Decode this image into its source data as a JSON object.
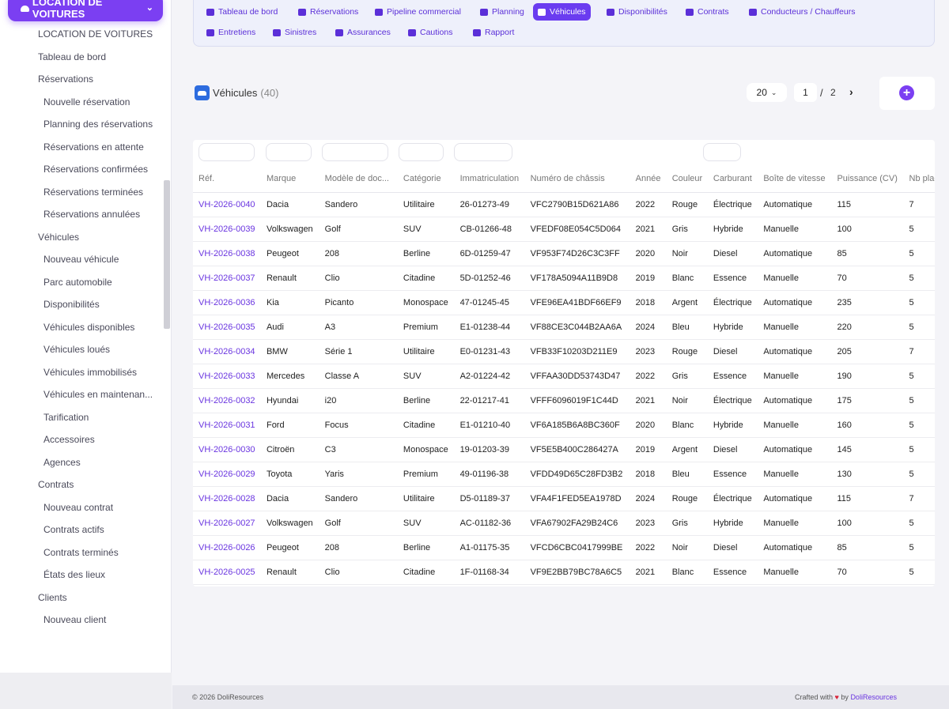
{
  "module": {
    "label": "LOCATION DE VOITURES"
  },
  "sidebar": {
    "items": [
      {
        "label": "LOCATION DE VOITURES",
        "level": 1
      },
      {
        "label": "Tableau de bord",
        "level": 1
      },
      {
        "label": "Réservations",
        "level": 1
      },
      {
        "label": "Nouvelle réservation",
        "level": 2
      },
      {
        "label": "Planning des réservations",
        "level": 2
      },
      {
        "label": "Réservations en attente",
        "level": 2
      },
      {
        "label": "Réservations confirmées",
        "level": 2
      },
      {
        "label": "Réservations terminées",
        "level": 2
      },
      {
        "label": "Réservations annulées",
        "level": 2
      },
      {
        "label": "Véhicules",
        "level": 1
      },
      {
        "label": "Nouveau véhicule",
        "level": 2
      },
      {
        "label": "Parc automobile",
        "level": 2
      },
      {
        "label": "Disponibilités",
        "level": 2
      },
      {
        "label": "Véhicules disponibles",
        "level": 2
      },
      {
        "label": "Véhicules loués",
        "level": 2
      },
      {
        "label": "Véhicules immobilisés",
        "level": 2
      },
      {
        "label": "Véhicules en maintenan...",
        "level": 2
      },
      {
        "label": "Tarification",
        "level": 2
      },
      {
        "label": "Accessoires",
        "level": 2
      },
      {
        "label": "Agences",
        "level": 2
      },
      {
        "label": "Contrats",
        "level": 1
      },
      {
        "label": "Nouveau contrat",
        "level": 2
      },
      {
        "label": "Contrats actifs",
        "level": 2
      },
      {
        "label": "Contrats terminés",
        "level": 2
      },
      {
        "label": "États des lieux",
        "level": 2
      },
      {
        "label": "Clients",
        "level": 1
      },
      {
        "label": "Nouveau client",
        "level": 2
      }
    ]
  },
  "tabs": [
    {
      "label": "Tableau de bord",
      "icon": "gauge-icon",
      "active": false
    },
    {
      "label": "Réservations",
      "icon": "calendar-check-icon",
      "active": false
    },
    {
      "label": "Pipeline commercial",
      "icon": "bars-icon",
      "active": false
    },
    {
      "label": "Planning",
      "icon": "calendar-icon",
      "active": false
    },
    {
      "label": "Véhicules",
      "icon": "car-icon",
      "active": true
    },
    {
      "label": "Disponibilités",
      "icon": "grid-icon",
      "active": false
    },
    {
      "label": "Contrats",
      "icon": "file-signature-icon",
      "active": false
    },
    {
      "label": "Conducteurs / Chauffeurs",
      "icon": "id-card-icon",
      "active": false
    },
    {
      "label": "Entretiens",
      "icon": "wrench-icon",
      "active": false
    },
    {
      "label": "Sinistres",
      "icon": "car-crash-icon",
      "active": false
    },
    {
      "label": "Assurances",
      "icon": "shield-icon",
      "active": false
    },
    {
      "label": "Cautions",
      "icon": "money-icon",
      "active": false
    },
    {
      "label": "Rapport",
      "icon": "chart-pie-icon",
      "active": false
    }
  ],
  "page": {
    "title": "Véhicules",
    "count": "(40)"
  },
  "pagination": {
    "per_page": "20",
    "current": "1",
    "separator": "/",
    "total": "2",
    "next": "›"
  },
  "add": {
    "label": "+"
  },
  "table": {
    "columns": [
      "Réf.",
      "Marque",
      "Modèle de doc...",
      "Catégorie",
      "Immatriculation",
      "Numéro de châssis",
      "Année",
      "Couleur",
      "Carburant",
      "Boîte de vitesse",
      "Puissance (CV)",
      "Nb places"
    ],
    "rows": [
      [
        "VH-2026-0040",
        "Dacia",
        "Sandero",
        "Utilitaire",
        "26-01273-49",
        "VFC2790B15D621A86",
        "2022",
        "Rouge",
        "Électrique",
        "Automatique",
        "115",
        "7"
      ],
      [
        "VH-2026-0039",
        "Volkswagen",
        "Golf",
        "SUV",
        "CB-01266-48",
        "VFEDF08E054C5D064",
        "2021",
        "Gris",
        "Hybride",
        "Manuelle",
        "100",
        "5"
      ],
      [
        "VH-2026-0038",
        "Peugeot",
        "208",
        "Berline",
        "6D-01259-47",
        "VF953F74D26C3C3FF",
        "2020",
        "Noir",
        "Diesel",
        "Automatique",
        "85",
        "5"
      ],
      [
        "VH-2026-0037",
        "Renault",
        "Clio",
        "Citadine",
        "5D-01252-46",
        "VF178A5094A11B9D8",
        "2019",
        "Blanc",
        "Essence",
        "Manuelle",
        "70",
        "5"
      ],
      [
        "VH-2026-0036",
        "Kia",
        "Picanto",
        "Monospace",
        "47-01245-45",
        "VFE96EA41BDF66EF9",
        "2018",
        "Argent",
        "Électrique",
        "Automatique",
        "235",
        "5"
      ],
      [
        "VH-2026-0035",
        "Audi",
        "A3",
        "Premium",
        "E1-01238-44",
        "VF88CE3C044B2AA6A",
        "2024",
        "Bleu",
        "Hybride",
        "Manuelle",
        "220",
        "5"
      ],
      [
        "VH-2026-0034",
        "BMW",
        "Série 1",
        "Utilitaire",
        "E0-01231-43",
        "VFB33F10203D211E9",
        "2023",
        "Rouge",
        "Diesel",
        "Automatique",
        "205",
        "7"
      ],
      [
        "VH-2026-0033",
        "Mercedes",
        "Classe A",
        "SUV",
        "A2-01224-42",
        "VFFAA30DD53743D47",
        "2022",
        "Gris",
        "Essence",
        "Manuelle",
        "190",
        "5"
      ],
      [
        "VH-2026-0032",
        "Hyundai",
        "i20",
        "Berline",
        "22-01217-41",
        "VFFF6096019F1C44D",
        "2021",
        "Noir",
        "Électrique",
        "Automatique",
        "175",
        "5"
      ],
      [
        "VH-2026-0031",
        "Ford",
        "Focus",
        "Citadine",
        "E1-01210-40",
        "VF6A185B6A8BC360F",
        "2020",
        "Blanc",
        "Hybride",
        "Manuelle",
        "160",
        "5"
      ],
      [
        "VH-2026-0030",
        "Citroën",
        "C3",
        "Monospace",
        "19-01203-39",
        "VF5E5B400C286427A",
        "2019",
        "Argent",
        "Diesel",
        "Automatique",
        "145",
        "5"
      ],
      [
        "VH-2026-0029",
        "Toyota",
        "Yaris",
        "Premium",
        "49-01196-38",
        "VFDD49D65C28FD3B2",
        "2018",
        "Bleu",
        "Essence",
        "Manuelle",
        "130",
        "5"
      ],
      [
        "VH-2026-0028",
        "Dacia",
        "Sandero",
        "Utilitaire",
        "D5-01189-37",
        "VFA4F1FED5EA1978D",
        "2024",
        "Rouge",
        "Électrique",
        "Automatique",
        "115",
        "7"
      ],
      [
        "VH-2026-0027",
        "Volkswagen",
        "Golf",
        "SUV",
        "AC-01182-36",
        "VFA67902FA29B24C6",
        "2023",
        "Gris",
        "Hybride",
        "Manuelle",
        "100",
        "5"
      ],
      [
        "VH-2026-0026",
        "Peugeot",
        "208",
        "Berline",
        "A1-01175-35",
        "VFCD6CBC0417999BE",
        "2022",
        "Noir",
        "Diesel",
        "Automatique",
        "85",
        "5"
      ],
      [
        "VH-2026-0025",
        "Renault",
        "Clio",
        "Citadine",
        "1F-01168-34",
        "VF9E2BB79BC78A6C5",
        "2021",
        "Blanc",
        "Essence",
        "Manuelle",
        "70",
        "5"
      ]
    ]
  },
  "footer": {
    "copyright": "© 2026 DoliResources",
    "crafted": "Crafted with",
    "heart": "♥",
    "by": "by",
    "brand": "DoliResources"
  },
  "colors": {
    "accent": "#7b3ff2",
    "link": "#6a35e0"
  }
}
